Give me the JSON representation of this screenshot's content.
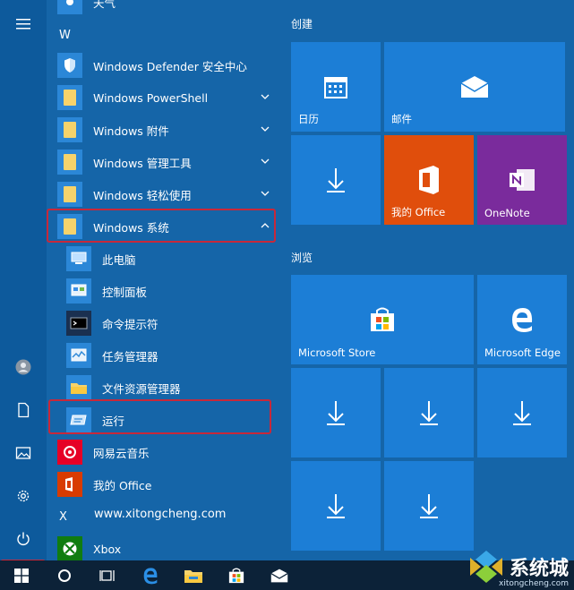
{
  "applist": {
    "top_partial_label": "天气",
    "letters": {
      "w": "W",
      "x": "X"
    },
    "apps": [
      {
        "label": "Windows Defender 安全中心",
        "icon": "shield-icon"
      },
      {
        "label": "Windows PowerShell",
        "icon": "folder-icon"
      },
      {
        "label": "Windows 附件",
        "icon": "folder-icon"
      },
      {
        "label": "Windows 管理工具",
        "icon": "folder-icon"
      },
      {
        "label": "Windows 轻松使用",
        "icon": "folder-icon"
      },
      {
        "label": "Windows 系统",
        "icon": "folder-icon"
      }
    ],
    "system_items": [
      {
        "label": "此电脑",
        "icon": "computer-icon"
      },
      {
        "label": "控制面板",
        "icon": "control-panel-icon"
      },
      {
        "label": "命令提示符",
        "icon": "cmd-icon"
      },
      {
        "label": "任务管理器",
        "icon": "task-manager-icon"
      },
      {
        "label": "文件资源管理器",
        "icon": "file-explorer-icon"
      },
      {
        "label": "运行",
        "icon": "run-icon"
      }
    ],
    "after": [
      {
        "label": "网易云音乐",
        "icon": "netease-music-icon"
      },
      {
        "label": "我的 Office",
        "icon": "office-icon"
      }
    ],
    "x_row_label": "www.xitongcheng.com",
    "xbox": {
      "label": "Xbox",
      "icon": "xbox-icon"
    }
  },
  "tiles": {
    "section1": "创建",
    "section2": "浏览",
    "calendar": "日历",
    "mail": "邮件",
    "my_office": "我的 Office",
    "onenote": "OneNote",
    "store": "Microsoft Store",
    "edge": "Microsoft Edge"
  },
  "watermark": {
    "text": "系统城",
    "sub": "xitongcheng.com"
  },
  "colors": {
    "accent": "#1c7ed6",
    "background": "#1565a8",
    "office": "#e04e0c",
    "onenote": "#7a2b9c",
    "highlight": "#c8283a"
  }
}
